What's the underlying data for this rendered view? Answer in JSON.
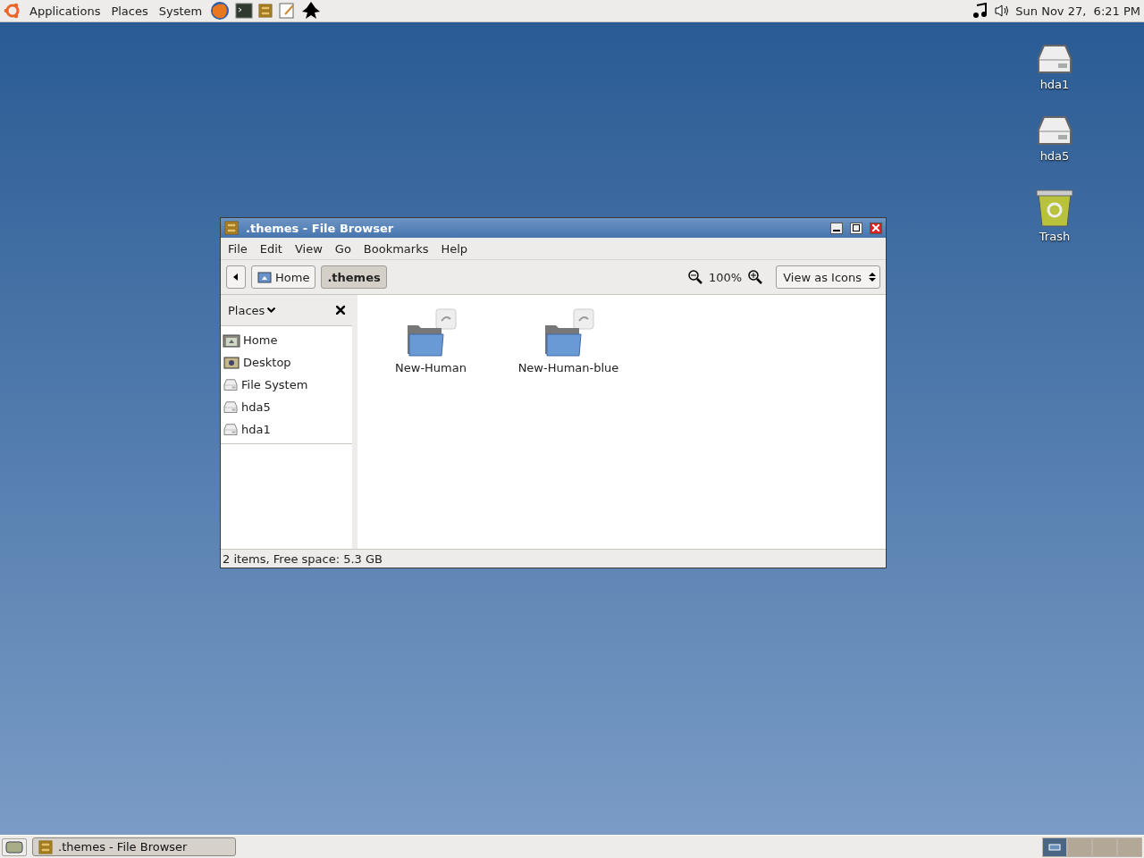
{
  "top_panel": {
    "menus": [
      "Applications",
      "Places",
      "System"
    ],
    "clock": "Sun Nov 27,  6:21 PM"
  },
  "desktop_icons": [
    {
      "label": "hda1",
      "kind": "drive"
    },
    {
      "label": "hda5",
      "kind": "drive"
    },
    {
      "label": "Trash",
      "kind": "trash"
    }
  ],
  "window": {
    "title": ".themes - File Browser",
    "menu": [
      "File",
      "Edit",
      "View",
      "Go",
      "Bookmarks",
      "Help"
    ],
    "path": [
      {
        "label": "Home",
        "selected": false
      },
      {
        "label": ".themes",
        "selected": true
      }
    ],
    "zoom": "100%",
    "view_select": "View as Icons",
    "sidebar": {
      "title": "Places",
      "items": [
        {
          "label": "Home",
          "kind": "home"
        },
        {
          "label": "Desktop",
          "kind": "desktop"
        },
        {
          "label": "File System",
          "kind": "drive"
        },
        {
          "label": "hda5",
          "kind": "drive"
        },
        {
          "label": "hda1",
          "kind": "drive"
        }
      ]
    },
    "files": [
      {
        "name": "New-Human"
      },
      {
        "name": "New-Human-blue"
      }
    ],
    "status_bar": "2 items, Free space: 5.3 GB"
  },
  "bottom_panel": {
    "tasks": [
      {
        "label": ".themes - File Browser"
      }
    ],
    "workspaces": [
      {
        "selected": true
      },
      {
        "selected": false
      },
      {
        "selected": false
      },
      {
        "selected": false
      }
    ]
  }
}
